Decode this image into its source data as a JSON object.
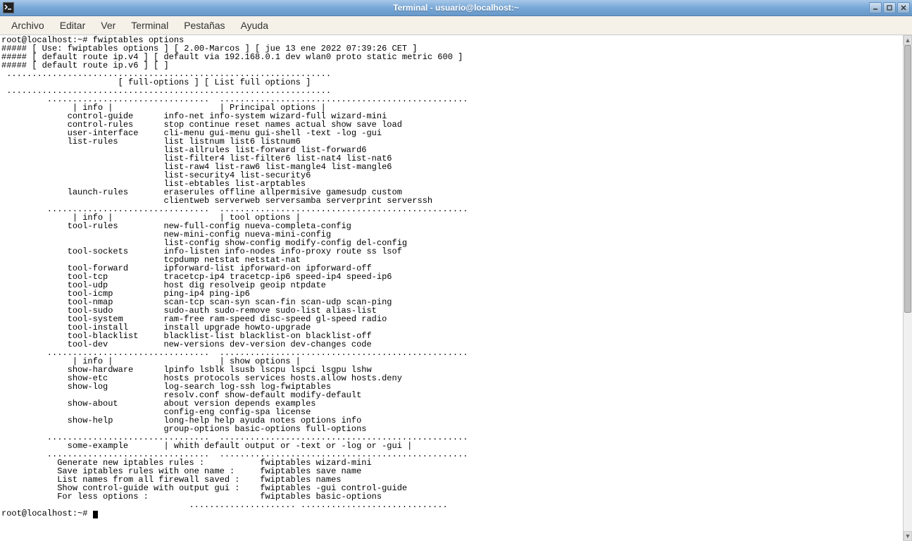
{
  "window": {
    "title": "Terminal - usuario@localhost:~"
  },
  "menubar": {
    "items": [
      "Archivo",
      "Editar",
      "Ver",
      "Terminal",
      "Pestañas",
      "Ayuda"
    ]
  },
  "terminal": {
    "prompt1": "root@localhost:~# ",
    "command1": "fwiptables options",
    "header_line1": "##### [ Use: fwiptables options ] [ 2.00-Marcos ] [ jue 13 ene 2022 07:39:26 CET ]",
    "header_line2": "##### [ default route ip.v4 ] [ default via 192.168.0.1 dev wlan0 proto static metric 600 ]",
    "header_line3": "##### [ default route ip.v6 ] [ ]",
    "full_options_label": "                       [ full-options ] [ List full options ]",
    "sep_top": " ................................................................",
    "sep_mid": "         ................................  .................................................",
    "sep_small": "                                     ..................... .............................",
    "principal_header": "              | info |                     | Principal options |",
    "rows_principal": [
      "             control-guide      info-net info-system wizard-full wizard-mini",
      "             control-rules      stop continue reset names actual show save load",
      "             user-interface     cli-menu gui-menu gui-shell -text -log -gui",
      "             list-rules         list listnum list6 listnum6",
      "                                list-allrules list-forward list-forward6",
      "                                list-filter4 list-filter6 list-nat4 list-nat6",
      "                                list-raw4 list-raw6 list-mangle4 list-mangle6",
      "                                list-security4 list-security6",
      "                                list-ebtables list-arptables",
      "             launch-rules       eraserules offline allpermisive gamesudp custom",
      "                                clientweb serverweb serversamba serverprint serverssh"
    ],
    "tool_header": "              | info |                     | tool options |",
    "rows_tool": [
      "             tool-rules         new-full-config nueva-completa-config",
      "                                new-mini-config nueva-mini-config",
      "                                list-config show-config modify-config del-config",
      "             tool-sockets       info-listen info-nodes info-proxy route ss lsof",
      "                                tcpdump netstat netstat-nat",
      "             tool-forward       ipforward-list ipforward-on ipforward-off",
      "             tool-tcp           tracetcp-ip4 tracetcp-ip6 speed-ip4 speed-ip6",
      "             tool-udp           host dig resolveip geoip ntpdate",
      "             tool-icmp          ping-ip4 ping-ip6",
      "             tool-nmap          scan-tcp scan-syn scan-fin scan-udp scan-ping",
      "             tool-sudo          sudo-auth sudo-remove sudo-list alias-list",
      "             tool-system        ram-free ram-speed disc-speed gl-speed radio",
      "             tool-install       install upgrade howto-upgrade",
      "             tool-blacklist     blacklist-list blacklist-on blacklist-off",
      "             tool-dev           new-versions dev-version dev-changes code"
    ],
    "show_header": "              | info |                     | show options |",
    "rows_show": [
      "             show-hardware      lpinfo lsblk lsusb lscpu lspci lsgpu lshw",
      "             show-etc           hosts protocols services hosts.allow hosts.deny",
      "             show-log           log-search log-ssh log-fwiptables",
      "                                resolv.conf show-default modify-default",
      "             show-about         about version depends examples",
      "                                config-eng config-spa license",
      "             show-help          long-help help ayuda notes options info",
      "                                group-options basic-options full-options"
    ],
    "example_header": "             some-example       | whith default output or -text or -log or -gui |",
    "rows_example": [
      "           Generate new iptables rules :           fwiptables wizard-mini",
      "           Save iptables rules with one name :     fwiptables save name",
      "           List names from all firewall saved :    fwiptables names",
      "           Show control-guide with output gui :    fwiptables -gui control-guide",
      "           For less options :                      fwiptables basic-options"
    ],
    "prompt2": "root@localhost:~# "
  }
}
